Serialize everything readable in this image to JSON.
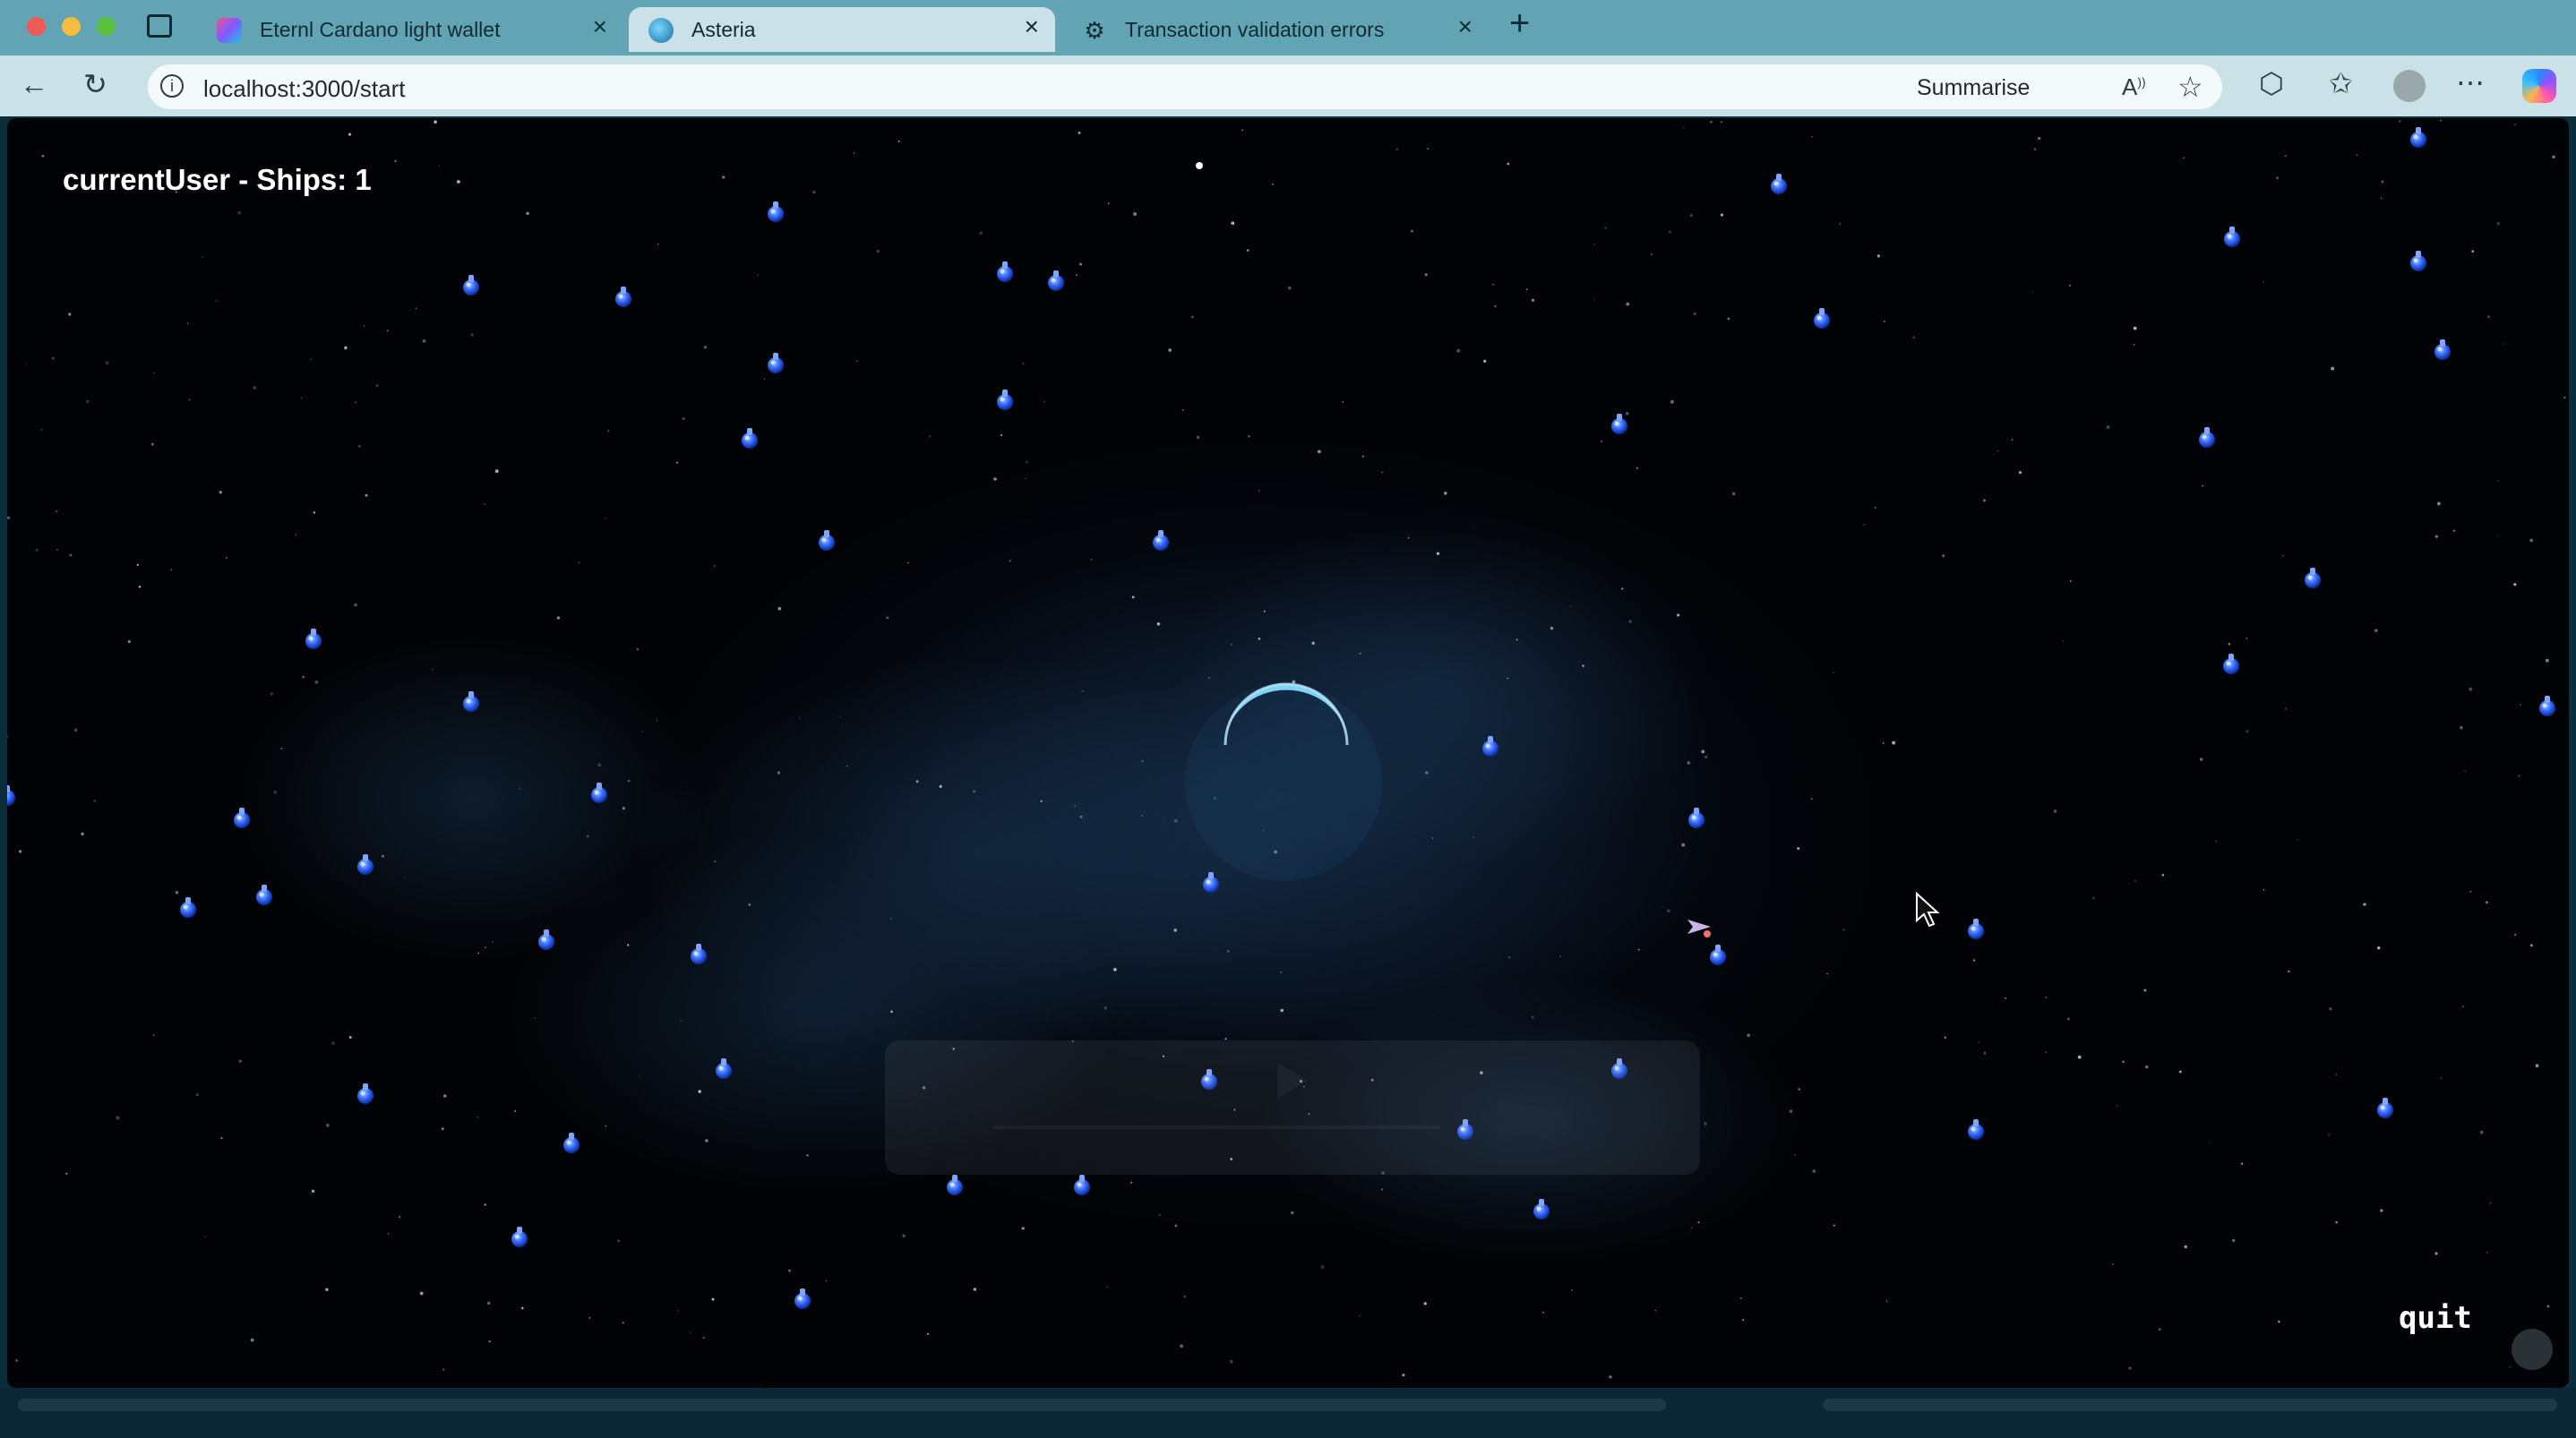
{
  "browser": {
    "traffic_lights": [
      "#ee5b55",
      "#f5bd3b",
      "#5ac13f"
    ],
    "tabs": [
      {
        "label": "Eternl Cardano light wallet",
        "icon": "eternl-favicon-icon",
        "active": false
      },
      {
        "label": "Asteria",
        "icon": "globe-favicon-icon",
        "active": true
      },
      {
        "label": "Transaction validation errors",
        "icon": "gear-favicon-icon",
        "active": false
      }
    ],
    "address": "localhost:3000/start",
    "summarise_label": "Summarise",
    "colors": {
      "frame": "#63a4b4",
      "toolbar": "#c9e1e7"
    }
  },
  "game": {
    "hud_user": "currentUser - Ships: 1",
    "quit_label": "quit",
    "colors": {
      "space": "#03050b",
      "fuel": "#2f66ff",
      "planet": "#4fb6e6"
    }
  }
}
